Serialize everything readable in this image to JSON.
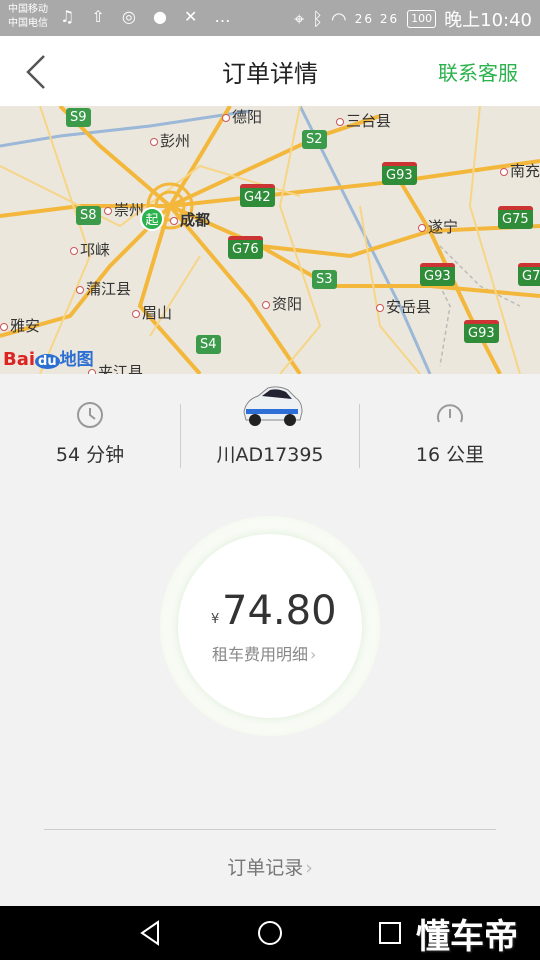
{
  "status_bar": {
    "carrier_1": "中国移动",
    "carrier_2": "中国电信",
    "left_icons": "♫ ⇧ ◎ ● ✕ …",
    "signal": "26 26",
    "battery": "100",
    "time": "晚上10:40"
  },
  "header": {
    "title": "订单详情",
    "customer_service": "联系客服",
    "accent_color": "#2bb24c"
  },
  "map": {
    "cities": {
      "deyang": "德阳",
      "pengzhou": "彭州",
      "santai": "三台县",
      "nanchong": "南充",
      "chongzhou": "崇州",
      "chengdu": "成都",
      "suining": "遂宁",
      "qionglai": "邛崃",
      "pujiang": "蒲江县",
      "ziyang": "资阳",
      "anyue": "安岳县",
      "yaan": "雅安",
      "meishan": "眉山",
      "jiajiang": "夹江县"
    },
    "shields": {
      "s9": "S9",
      "s2": "S2",
      "g93a": "G93",
      "g42": "G42",
      "s8": "S8",
      "g75": "G75",
      "g76": "G76",
      "s3": "S3",
      "g93b": "G93",
      "g7x": "G7",
      "s4": "S4",
      "g93c": "G93"
    },
    "start_marker": "起",
    "logo": {
      "bai": "Bai",
      "du": "du",
      "ditu": "地图"
    }
  },
  "stats": {
    "duration": "54 分钟",
    "plate": "川AD17395",
    "distance": "16 公里",
    "icons": [
      "clock-icon",
      "car-image",
      "speedometer-icon"
    ]
  },
  "fee": {
    "currency": "¥",
    "amount": "74.80",
    "detail_link": "租车费用明细"
  },
  "records_link": "订单记录",
  "nav": {
    "buttons": [
      "back-triangle-icon",
      "home-circle-icon",
      "recents-square-icon"
    ]
  },
  "watermark": "懂车帝"
}
